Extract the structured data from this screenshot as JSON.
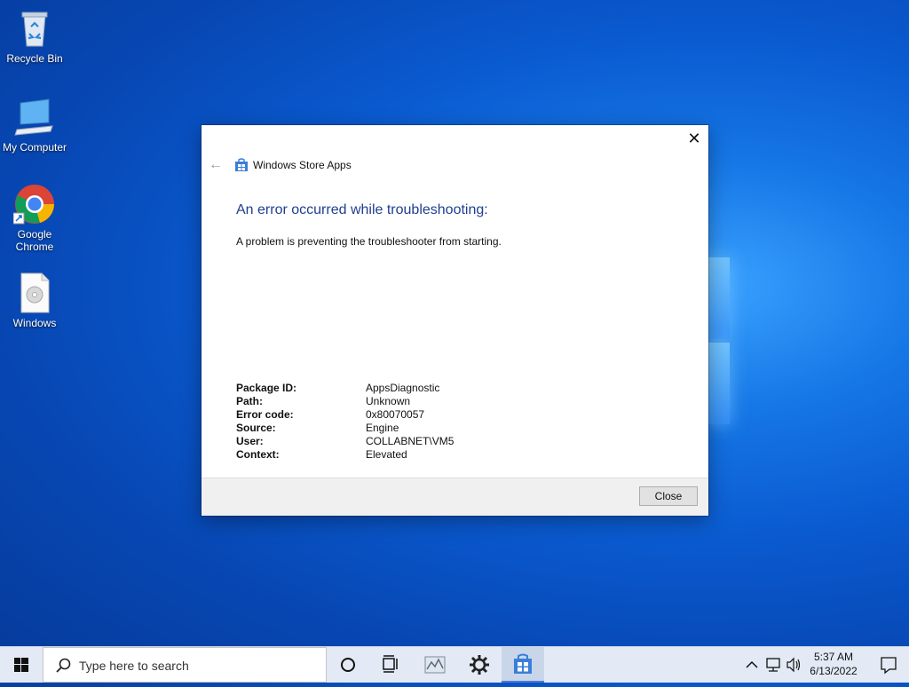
{
  "desktop": {
    "icons": [
      {
        "label": "Recycle Bin",
        "icon": "recycle-bin-icon"
      },
      {
        "label": "My Computer",
        "icon": "computer-icon"
      },
      {
        "label": "Google Chrome",
        "icon": "chrome-icon"
      },
      {
        "label": "Windows",
        "icon": "disc-file-icon"
      }
    ]
  },
  "dialog": {
    "app_title": "Windows Store Apps",
    "heading": "An error occurred while troubleshooting:",
    "message": "A problem is preventing the troubleshooter from starting.",
    "details": [
      {
        "key": "Package ID:",
        "value": "AppsDiagnostic"
      },
      {
        "key": "Path:",
        "value": "Unknown"
      },
      {
        "key": "Error code:",
        "value": "0x80070057"
      },
      {
        "key": "Source:",
        "value": "Engine"
      },
      {
        "key": "User:",
        "value": "COLLABNET\\VM5"
      },
      {
        "key": "Context:",
        "value": "Elevated"
      }
    ],
    "close_button": "Close",
    "heading_color": "#1e3f8f"
  },
  "taskbar": {
    "search_placeholder": "Type here to search",
    "time": "5:37 AM",
    "date": "6/13/2022",
    "accent": "#4a7bd1"
  }
}
